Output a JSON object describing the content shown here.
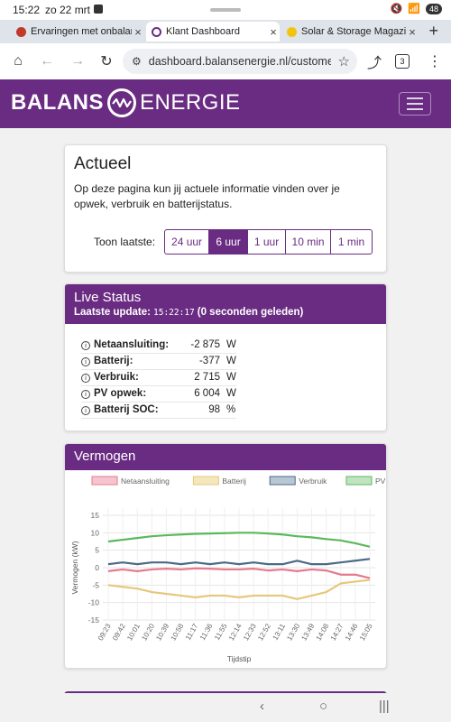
{
  "status_bar": {
    "time": "15:22",
    "date": "zo 22 mrt",
    "battery": "48"
  },
  "browser": {
    "tabs": [
      {
        "title": "Ervaringen met onbalan",
        "favicon_color": "#c0392b",
        "active": false
      },
      {
        "title": "Klant Dashboard",
        "favicon_color": "#6a2c82",
        "active": true
      },
      {
        "title": "Solar & Storage Magazi",
        "favicon_color": "#f1c40f",
        "active": false
      }
    ],
    "url": "dashboard.balansenergie.nl/customer",
    "tab_count": "3",
    "icons": [
      "home-icon",
      "back-icon",
      "forward-icon",
      "reload-icon",
      "site-settings-icon",
      "star-icon",
      "share-icon",
      "tab-count-icon",
      "menu-icon"
    ]
  },
  "site": {
    "logo_left": "BALANS",
    "logo_right": "ENERGIE",
    "brand_color": "#6a2c82"
  },
  "actueel": {
    "title": "Actueel",
    "description": "Op deze pagina kun jij actuele informatie vinden over je opwek, verbruik en batterijstatus.",
    "toon_label": "Toon laatste:",
    "ranges": [
      {
        "label": "24 uur",
        "active": false
      },
      {
        "label": "6 uur",
        "active": true
      },
      {
        "label": "1 uur",
        "active": false
      },
      {
        "label": "10 min",
        "active": false
      },
      {
        "label": "1 min",
        "active": false
      }
    ]
  },
  "live_status": {
    "title": "Live Status",
    "update_label": "Laatste update:",
    "update_time": "15:22:17",
    "update_ago": "(0 seconden geleden)",
    "rows": [
      {
        "label": "Netaansluiting:",
        "value": "-2 875",
        "unit": "W"
      },
      {
        "label": "Batterij:",
        "value": "-377",
        "unit": "W"
      },
      {
        "label": "Verbruik:",
        "value": "2 715",
        "unit": "W"
      },
      {
        "label": "PV opwek:",
        "value": "6 004",
        "unit": "W"
      },
      {
        "label": "Batterij SOC:",
        "value": "98",
        "unit": "%"
      }
    ]
  },
  "vermogen": {
    "title": "Vermogen"
  },
  "chart_data": {
    "type": "line",
    "xlabel": "Tijdstip",
    "ylabel": "Vermogen (kW)",
    "ylim": [
      -15,
      15
    ],
    "yticks": [
      15,
      10,
      5,
      0,
      -5,
      -10,
      -15
    ],
    "grid": true,
    "legend_position": "top",
    "x": [
      "09:23",
      "09:42",
      "10:01",
      "10:20",
      "10:39",
      "10:58",
      "11:17",
      "11:36",
      "11:55",
      "12:14",
      "12:33",
      "12:52",
      "13:11",
      "13:30",
      "13:49",
      "14:08",
      "14:27",
      "14:46",
      "15:05"
    ],
    "series": [
      {
        "name": "Netaansluiting",
        "color": "#e57a8f",
        "fill": "#f6c4cf",
        "values": [
          -1,
          -0.5,
          -1,
          -0.5,
          -0.3,
          -0.5,
          -0.2,
          -0.3,
          -0.5,
          -0.5,
          -0.3,
          -0.8,
          -0.5,
          -1,
          -0.5,
          -0.8,
          -2,
          -2,
          -3
        ]
      },
      {
        "name": "Batterij",
        "color": "#e6c87a",
        "fill": "#f4e6bd",
        "values": [
          -5,
          -5.5,
          -6,
          -7,
          -7.5,
          -8,
          -8.5,
          -8,
          -8,
          -8.5,
          -8,
          -8,
          -8,
          -9,
          -8,
          -7,
          -4.5,
          -4,
          -3.5
        ]
      },
      {
        "name": "Verbruik",
        "color": "#4a6a8a",
        "fill": "#b9c6d4",
        "values": [
          1,
          1.5,
          1,
          1.5,
          1.5,
          1,
          1.5,
          1,
          1.5,
          1,
          1.5,
          1,
          1,
          2,
          1,
          1,
          1.5,
          2,
          2.5
        ]
      },
      {
        "name": "PV opwek",
        "color": "#5cb85c",
        "fill": "#bfe4bf",
        "values": [
          7.5,
          8,
          8.5,
          9,
          9.3,
          9.5,
          9.7,
          9.8,
          9.9,
          10,
          10,
          9.8,
          9.5,
          9,
          8.7,
          8.2,
          7.8,
          7,
          6
        ]
      }
    ]
  }
}
